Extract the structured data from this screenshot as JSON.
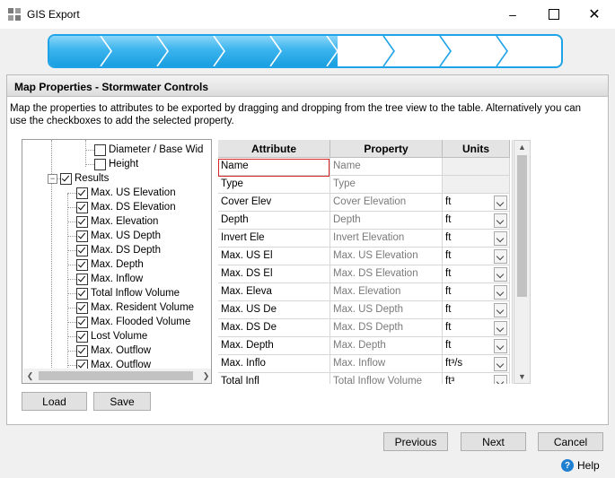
{
  "window": {
    "title": "GIS Export",
    "minimize_icon": "minimize-icon",
    "maximize_icon": "maximize-icon",
    "close_icon": "close-icon"
  },
  "wizard": {
    "steps_total": 9,
    "steps_completed": 5,
    "accent": "#1fa3e8"
  },
  "panel": {
    "title": "Map Properties - Stormwater Controls",
    "instructions": "Map the properties to attributes to be exported by dragging and dropping from the tree view to the table. Alternatively you can use the checkboxes to add the selected property."
  },
  "tree": {
    "items": [
      {
        "label": "Diameter / Base Wid",
        "checked": false
      },
      {
        "label": "Height",
        "checked": false
      },
      {
        "label": "Results",
        "checked": true,
        "expander": "−"
      },
      {
        "label": "Max. US Elevation",
        "checked": true
      },
      {
        "label": "Max. DS Elevation",
        "checked": true
      },
      {
        "label": "Max. Elevation",
        "checked": true
      },
      {
        "label": "Max. US Depth",
        "checked": true
      },
      {
        "label": "Max. DS Depth",
        "checked": true
      },
      {
        "label": "Max. Depth",
        "checked": true
      },
      {
        "label": "Max. Inflow",
        "checked": true
      },
      {
        "label": "Total Inflow Volume",
        "checked": true
      },
      {
        "label": "Max. Resident Volume",
        "checked": true
      },
      {
        "label": "Max. Flooded Volume",
        "checked": true
      },
      {
        "label": "Lost Volume",
        "checked": true
      },
      {
        "label": "Max. Outflow",
        "checked": true
      },
      {
        "label": "Max. Outflow",
        "checked": true
      }
    ]
  },
  "grid": {
    "headers": {
      "attribute": "Attribute",
      "property": "Property",
      "units": "Units"
    },
    "rows": [
      {
        "attribute": "Name",
        "property": "Name",
        "units": ""
      },
      {
        "attribute": "Type",
        "property": "Type",
        "units": ""
      },
      {
        "attribute": "Cover Elev",
        "property": "Cover Elevation",
        "units": "ft"
      },
      {
        "attribute": "Depth",
        "property": "Depth",
        "units": "ft"
      },
      {
        "attribute": "Invert Ele",
        "property": "Invert Elevation",
        "units": "ft"
      },
      {
        "attribute": "Max. US El",
        "property": "Max. US Elevation",
        "units": "ft"
      },
      {
        "attribute": "Max. DS El",
        "property": "Max. DS Elevation",
        "units": "ft"
      },
      {
        "attribute": "Max. Eleva",
        "property": "Max. Elevation",
        "units": "ft"
      },
      {
        "attribute": "Max. US De",
        "property": "Max. US Depth",
        "units": "ft"
      },
      {
        "attribute": "Max. DS De",
        "property": "Max. DS Depth",
        "units": "ft"
      },
      {
        "attribute": "Max. Depth",
        "property": "Max. Depth",
        "units": "ft"
      },
      {
        "attribute": "Max. Inflo",
        "property": "Max. Inflow",
        "units": "ft³/s"
      },
      {
        "attribute": "Total Infl",
        "property": "Total Inflow Volume",
        "units": "ft³"
      }
    ]
  },
  "buttons": {
    "load": "Load",
    "save": "Save",
    "previous": "Previous",
    "next": "Next",
    "cancel": "Cancel",
    "help": "Help"
  }
}
